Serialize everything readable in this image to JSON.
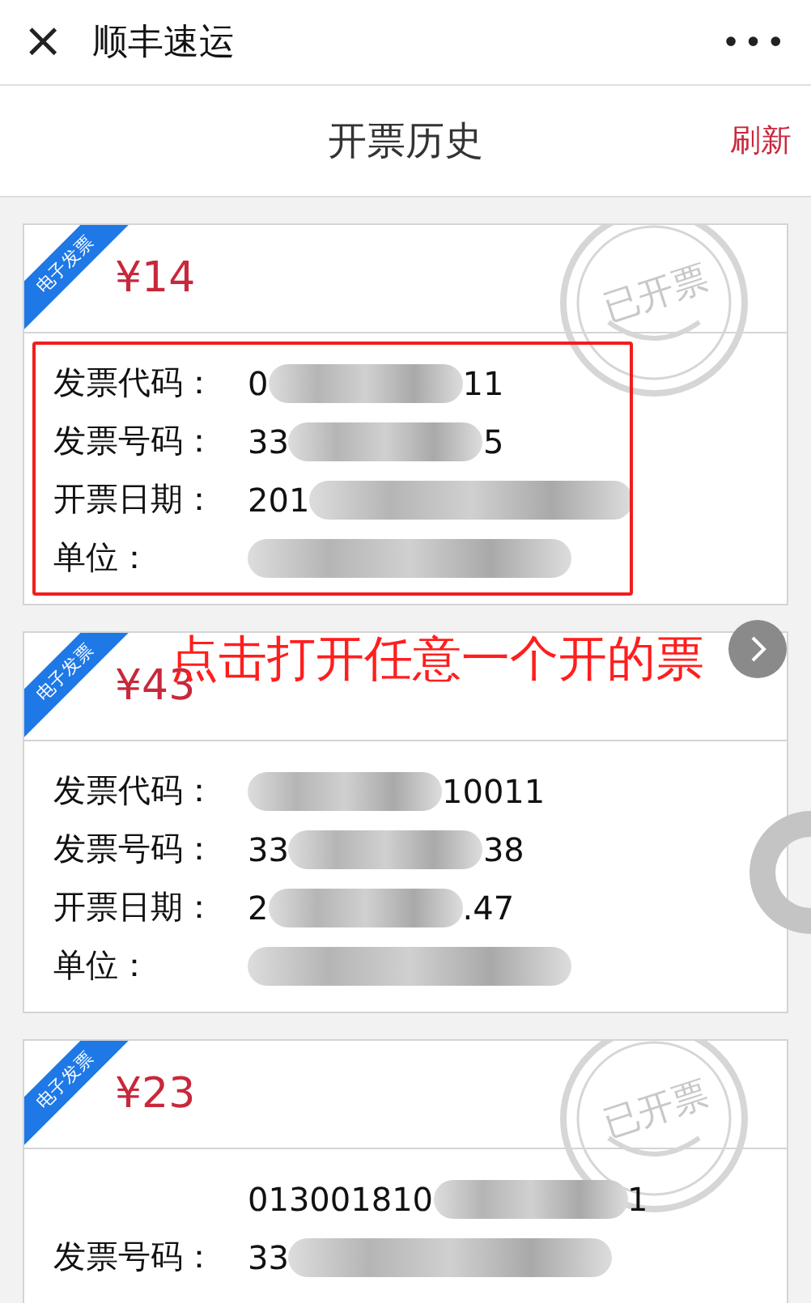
{
  "top_bar": {
    "close": "×",
    "title": "顺丰速运",
    "more": "•••"
  },
  "header": {
    "title": "开票历史",
    "refresh": "刷新"
  },
  "annotation": {
    "text": "点击打开任意一个开的票"
  },
  "invoices": [
    {
      "ribbon": "电子发票",
      "amount": "¥14",
      "stamp": "已开票",
      "highlighted": true,
      "fields": [
        {
          "label": "发票代码：",
          "value_start": "0",
          "value_end": "11"
        },
        {
          "label": "发票号码：",
          "value_start": "33",
          "value_end": "5"
        },
        {
          "label": "开票日期：",
          "value_start": "201"
        },
        {
          "label": "单位："
        }
      ]
    },
    {
      "ribbon": "电子发票",
      "amount": "¥43",
      "highlighted": false,
      "fields": [
        {
          "label": "发票代码：",
          "value_end": "10011"
        },
        {
          "label": "发票号码：",
          "value_start": "33",
          "value_end": "38"
        },
        {
          "label": "开票日期：",
          "value_start": "2",
          "value_end": ".47"
        },
        {
          "label": "单位："
        }
      ]
    },
    {
      "ribbon": "电子发票",
      "amount": "¥23",
      "stamp": "已开票",
      "highlighted": false,
      "fields": [
        {
          "value_start": "013001810",
          "value_end": "1"
        },
        {
          "label": "发票号码：",
          "value_start": "33"
        }
      ]
    }
  ]
}
